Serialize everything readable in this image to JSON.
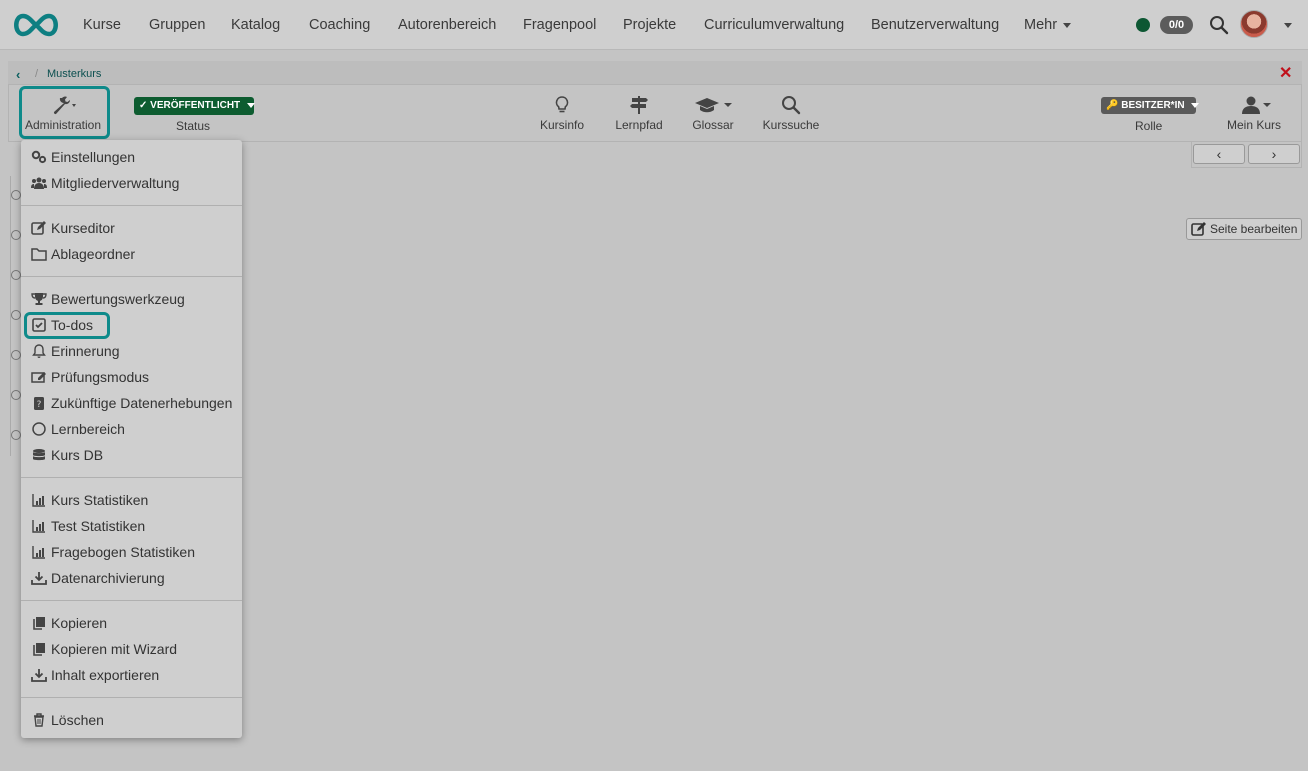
{
  "nav": {
    "items": [
      "Kurse",
      "Gruppen",
      "Katalog",
      "Coaching",
      "Autorenbereich",
      "Fragenpool",
      "Projekte",
      "Curriculumverwaltung",
      "Benutzerverwaltung",
      "Mehr"
    ],
    "count_badge": "0/0"
  },
  "breadcrumb": {
    "course": "Musterkurs"
  },
  "toolbar": {
    "admin": "Administration",
    "status_pill": "VERÖFFENTLICHT",
    "status_label": "Status",
    "kursinfo": "Kursinfo",
    "lernpfad": "Lernpfad",
    "glossar": "Glossar",
    "kurssuche": "Kurssuche",
    "role_pill": "BESITZER*IN",
    "role_label": "Rolle",
    "mein_kurs": "Mein Kurs"
  },
  "edit_page": "Seite bearbeiten",
  "menu": {
    "groups": [
      [
        "Einstellungen",
        "Mitgliederverwaltung"
      ],
      [
        "Kurseditor",
        "Ablageordner"
      ],
      [
        "Bewertungswerkzeug",
        "To-dos",
        "Erinnerung",
        "Prüfungsmodus",
        "Zukünftige Datenerhebungen",
        "Lernbereich",
        "Kurs DB"
      ],
      [
        "Kurs Statistiken",
        "Test Statistiken",
        "Fragebogen Statistiken",
        "Datenarchivierung"
      ],
      [
        "Kopieren",
        "Kopieren mit Wizard",
        "Inhalt exportieren"
      ],
      [
        "Löschen"
      ]
    ],
    "highlighted": "To-dos"
  },
  "colors": {
    "accent": "#0e8a8a",
    "published": "#0d5c30",
    "close": "#c0101a"
  }
}
